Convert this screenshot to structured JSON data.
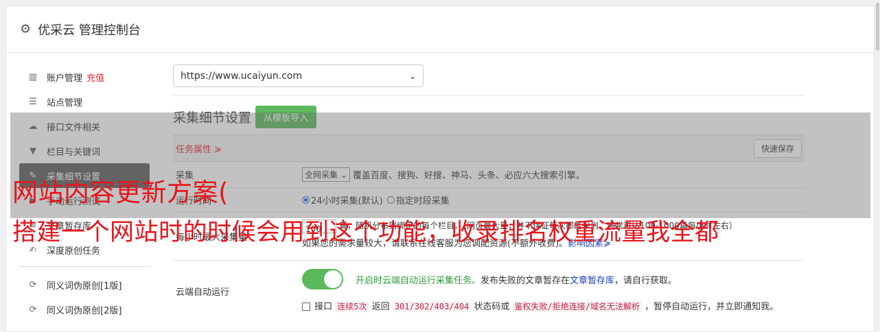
{
  "header": {
    "title": "优采云 管理控制台",
    "icon": "gear-icon"
  },
  "sidebar": {
    "items": [
      {
        "label": "账户管理",
        "extra": "充值",
        "icon": "bar-chart-icon"
      },
      {
        "label": "站点管理",
        "icon": "server-icon"
      },
      {
        "label": "接口文件相关",
        "icon": "cloud-upload-icon"
      },
      {
        "label": "栏目与关键词",
        "icon": "filter-icon"
      },
      {
        "label": "采集细节设置",
        "icon": "wrench-icon",
        "active": true
      },
      {
        "label": "手动运行测试",
        "icon": "play-circle-icon"
      },
      {
        "label": "文章暂存库",
        "icon": "database-icon"
      },
      {
        "label": "深度原创任务",
        "icon": "edit-icon"
      },
      {
        "label": "同义词伪原创[1版]",
        "icon": "refresh-icon"
      },
      {
        "label": "同义词伪原创[2版]",
        "icon": "refresh-icon"
      }
    ]
  },
  "site_select": {
    "value": "https://www.ucaiyun.com"
  },
  "section": {
    "title": "采集细节设置",
    "import_button": "从模板导入"
  },
  "task_bar": {
    "label": "任务属性 ≽",
    "save_button": "快速保存"
  },
  "rows": {
    "collect_type": {
      "label": "采集",
      "select_value": "全网采集",
      "desc": "覆盖百度、搜狗、好搜、神马、头条、必应六大搜索引擎。"
    },
    "run_time": {
      "label": "运行时间",
      "opt1": "24小时采集(默认)",
      "opt2": "指定时段采集"
    },
    "hourly_max": {
      "label": "每小时最大采集量",
      "input_value": "100",
      "line1": "篇，随机分布到绑定的每个栏目。（网页最大量，并不保证每次都能采到，通常可达100-1000篇每小时左右）",
      "line2": "如果您的需求量较大，请联系在线客服为您调配资源(不额外收费)。",
      "link": "影响因素≽"
    },
    "cloud_auto": {
      "label": "云端自动运行",
      "green_text": "开启时云端自动运行采集任务。",
      "desc_a": "发布失败的文章暂存在",
      "link": "文章暂存库",
      "desc_b": "，请自行获取。",
      "chk_label": "接口",
      "code1": "连续5次",
      "text1": "返回",
      "code2": "301/302/403/404",
      "text2": "状态码或",
      "code3": "鉴权失败/拒绝连接/域名无法解析",
      "text3": "，暂停自动运行，并立即通知我。"
    }
  },
  "watermark": {
    "line1": "网站内容更新方案(",
    "line2": "搭建一个网站时的时候会用到这个功能，收录排名权重流量我全都"
  },
  "colors": {
    "accent_green": "#5cb85c",
    "active_dark": "#5c5c5c",
    "red": "#e5282b",
    "link": "#1a3fbf"
  }
}
